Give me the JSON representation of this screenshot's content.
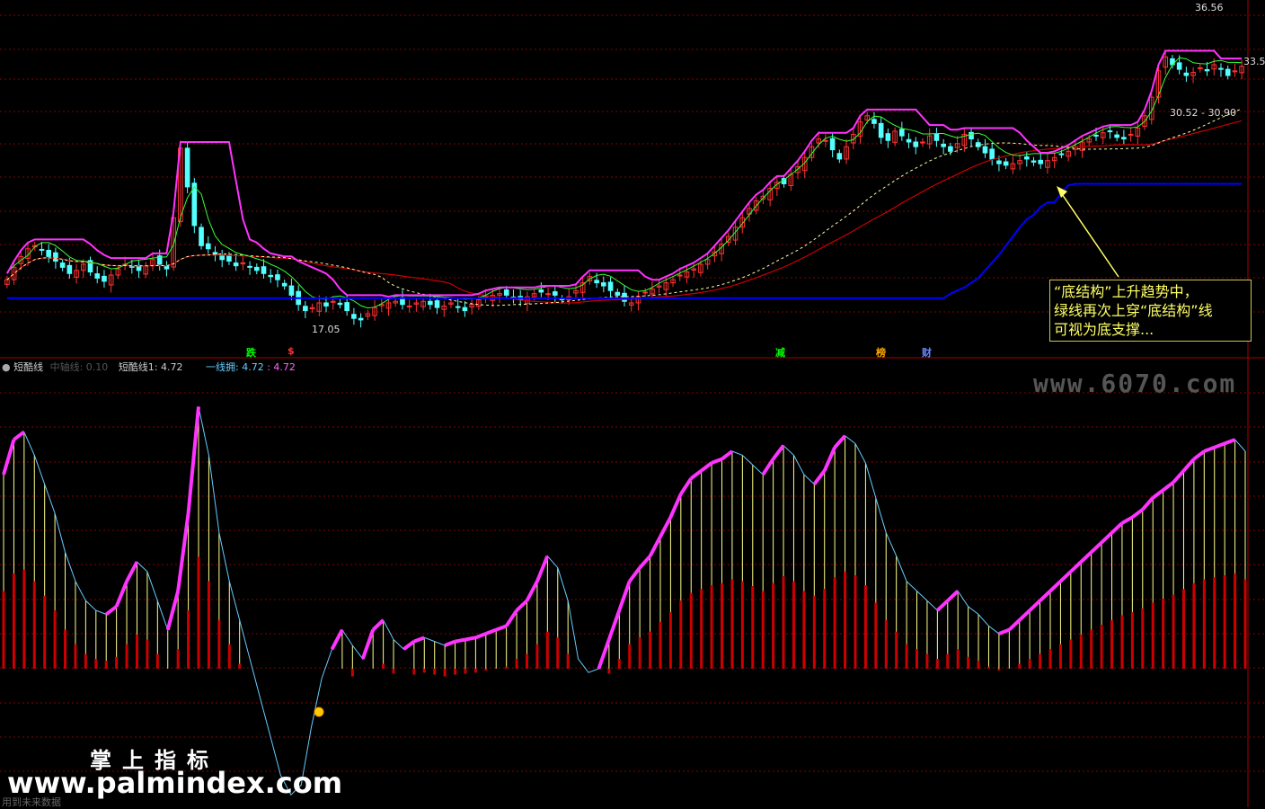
{
  "chart_data": [
    {
      "type": "candlestick",
      "panel": "main",
      "price_labels": [
        "36.56",
        "33.5",
        "30.52 - 30.90",
        "17.05"
      ],
      "ylim": [
        16,
        37.5
      ],
      "bars": 175,
      "close": [
        20.0,
        20.8,
        21.5,
        22.0,
        22.2,
        21.9,
        21.5,
        21.2,
        20.8,
        20.4,
        20.6,
        21.0,
        20.5,
        20.1,
        19.9,
        20.3,
        20.7,
        21.0,
        20.8,
        20.6,
        20.9,
        21.3,
        21.0,
        20.7,
        24.0,
        28.5,
        26.0,
        23.5,
        22.2,
        22.0,
        21.6,
        21.3,
        21.2,
        20.9,
        21.1,
        20.8,
        20.6,
        20.4,
        20.2,
        20.0,
        19.6,
        19.0,
        18.4,
        18.0,
        18.2,
        18.5,
        18.3,
        18.6,
        18.4,
        18.0,
        17.5,
        17.4,
        17.8,
        18.2,
        18.4,
        18.5,
        18.6,
        18.4,
        18.3,
        18.5,
        18.6,
        18.4,
        18.2,
        18.3,
        18.5,
        18.2,
        18.0,
        18.4,
        18.7,
        18.9,
        19.0,
        19.1,
        19.0,
        18.8,
        18.7,
        18.9,
        19.1,
        19.2,
        19.1,
        19.0,
        18.7,
        18.9,
        19.3,
        19.8,
        20.2,
        19.8,
        19.6,
        19.3,
        19.0,
        18.6,
        18.5,
        18.9,
        19.2,
        19.4,
        19.6,
        19.8,
        20.0,
        20.3,
        20.5,
        20.7,
        21.0,
        21.3,
        21.8,
        22.3,
        22.8,
        23.4,
        24.0,
        24.6,
        25.1,
        25.4,
        25.9,
        26.3,
        26.2,
        26.8,
        27.3,
        27.9,
        28.6,
        29.1,
        29.0,
        28.4,
        27.8,
        28.6,
        29.4,
        30.2,
        30.6,
        30.1,
        29.2,
        29.0,
        29.6,
        29.3,
        28.9,
        28.6,
        28.9,
        29.3,
        29.0,
        28.6,
        28.3,
        28.8,
        29.4,
        29.1,
        28.6,
        28.2,
        27.8,
        27.5,
        27.4,
        27.5,
        27.7,
        27.8,
        27.6,
        27.5,
        27.7,
        27.9,
        28.1,
        28.3,
        28.6,
        28.9,
        29.1,
        29.3,
        29.5,
        29.6,
        29.2,
        29.1,
        29.4,
        29.8,
        30.6,
        31.8,
        33.5,
        34.4,
        33.9,
        33.6,
        33.2,
        33.4,
        33.7,
        33.5,
        33.9,
        33.6,
        33.2,
        33.5,
        33.8
      ]
    },
    {
      "type": "line",
      "panel": "oscillator",
      "legend": {
        "name": "短酷线",
        "items": [
          {
            "label": "中轴线: 0.10",
            "color": "#555555"
          },
          {
            "label": "短酷线1: 4.72",
            "color": "#cccccc"
          },
          {
            "label": "一线拥: 4.72",
            "color": "#66ccff"
          },
          {
            "label": ": 4.72",
            "color": "#ff66ff"
          }
        ]
      },
      "ylim": [
        -110,
        110
      ],
      "values": [
        60,
        78,
        82,
        70,
        55,
        40,
        20,
        5,
        -5,
        -10,
        -12,
        -8,
        5,
        15,
        10,
        -5,
        -20,
        0,
        40,
        95,
        70,
        30,
        5,
        -15,
        -35,
        -55,
        -75,
        -95,
        -105,
        -100,
        -70,
        -45,
        -30,
        -20,
        -28,
        -35,
        -20,
        -15,
        -25,
        -30,
        -26,
        -24,
        -26,
        -28,
        -26,
        -25,
        -24,
        -22,
        -20,
        -18,
        -10,
        -5,
        5,
        18,
        12,
        -5,
        -35,
        -42,
        -40,
        -25,
        -10,
        5,
        12,
        18,
        28,
        38,
        50,
        58,
        62,
        66,
        68,
        72,
        70,
        65,
        60,
        68,
        75,
        70,
        60,
        55,
        62,
        74,
        80,
        76,
        66,
        48,
        30,
        18,
        5,
        0,
        -5,
        -10,
        -5,
        0,
        -8,
        -12,
        -18,
        -22,
        -20,
        -15,
        -10,
        -5,
        0,
        5,
        10,
        15,
        20,
        25,
        30,
        35,
        38,
        42,
        48,
        52,
        56,
        62,
        68,
        72,
        74,
        76,
        78,
        72
      ]
    },
    {
      "type": "markers",
      "panel": "main-bottom",
      "labels": [
        "跌",
        "$",
        "减",
        "榜",
        "财"
      ],
      "colors": [
        "#00ff00",
        "#ff3333",
        "#00ff00",
        "#ffaa00",
        "#6688ff"
      ]
    }
  ],
  "annotation": {
    "line1": "“底结构”上升趋势中，",
    "line2": "绿线再次上穿“底结构”线",
    "line3": "可视为底支撑..."
  },
  "watermarks": {
    "site1": "www.6070.com",
    "brand": "掌上指标",
    "site2": "www.palmindex.com"
  },
  "footer": "用到未来数据",
  "colors": {
    "up": "#ff3333",
    "down": "#54ffff",
    "magenta": "#ff33ff",
    "green": "#33ff33",
    "blue": "#0000ff",
    "red": "#cc0000",
    "yellow": "#ffff66",
    "grid": "#880000"
  }
}
